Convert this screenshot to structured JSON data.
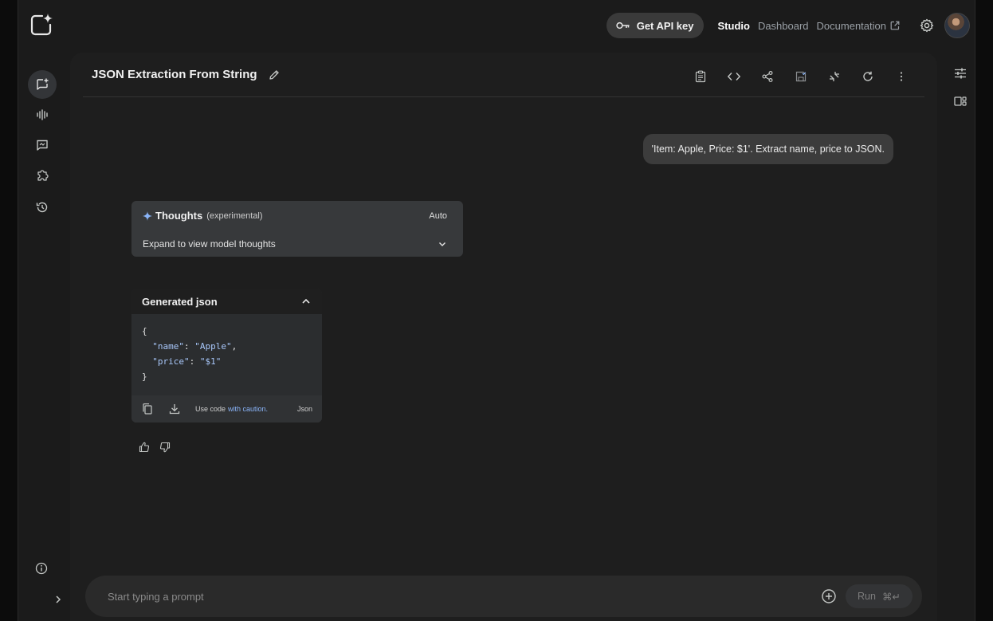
{
  "topbar": {
    "api_key_label": "Get API key",
    "nav": [
      "Studio",
      "Dashboard",
      "Documentation"
    ]
  },
  "sidebar": {
    "items": [
      {
        "icon": "chat-add-icon",
        "active": true
      },
      {
        "icon": "audio-wave-icon"
      },
      {
        "icon": "message-icon"
      },
      {
        "icon": "extension-icon"
      },
      {
        "icon": "history-icon"
      }
    ]
  },
  "chat": {
    "title": "JSON Extraction From String",
    "user_message": "'Item: Apple, Price: $1'. Extract name, price to JSON.",
    "thoughts": {
      "title": "Thoughts",
      "tag": "(experimental)",
      "mode": "Auto",
      "expand_label": "Expand to view model thoughts"
    },
    "code_block": {
      "header": "Generated json",
      "lines": {
        "open": "{",
        "name_key": "\"name\"",
        "name_val": "\"Apple\"",
        "price_key": "\"price\"",
        "price_val": "\"$1\"",
        "close": "}"
      },
      "caution_prefix": "Use code",
      "caution_link": "with caution.",
      "language": "Json"
    }
  },
  "prompt": {
    "placeholder": "Start typing a prompt",
    "run_label": "Run",
    "shortcut": "⌘↵"
  },
  "colors": {
    "background": "#1b1b1b",
    "panel": "#1e1e1e",
    "accent": "#8ab4f8"
  }
}
